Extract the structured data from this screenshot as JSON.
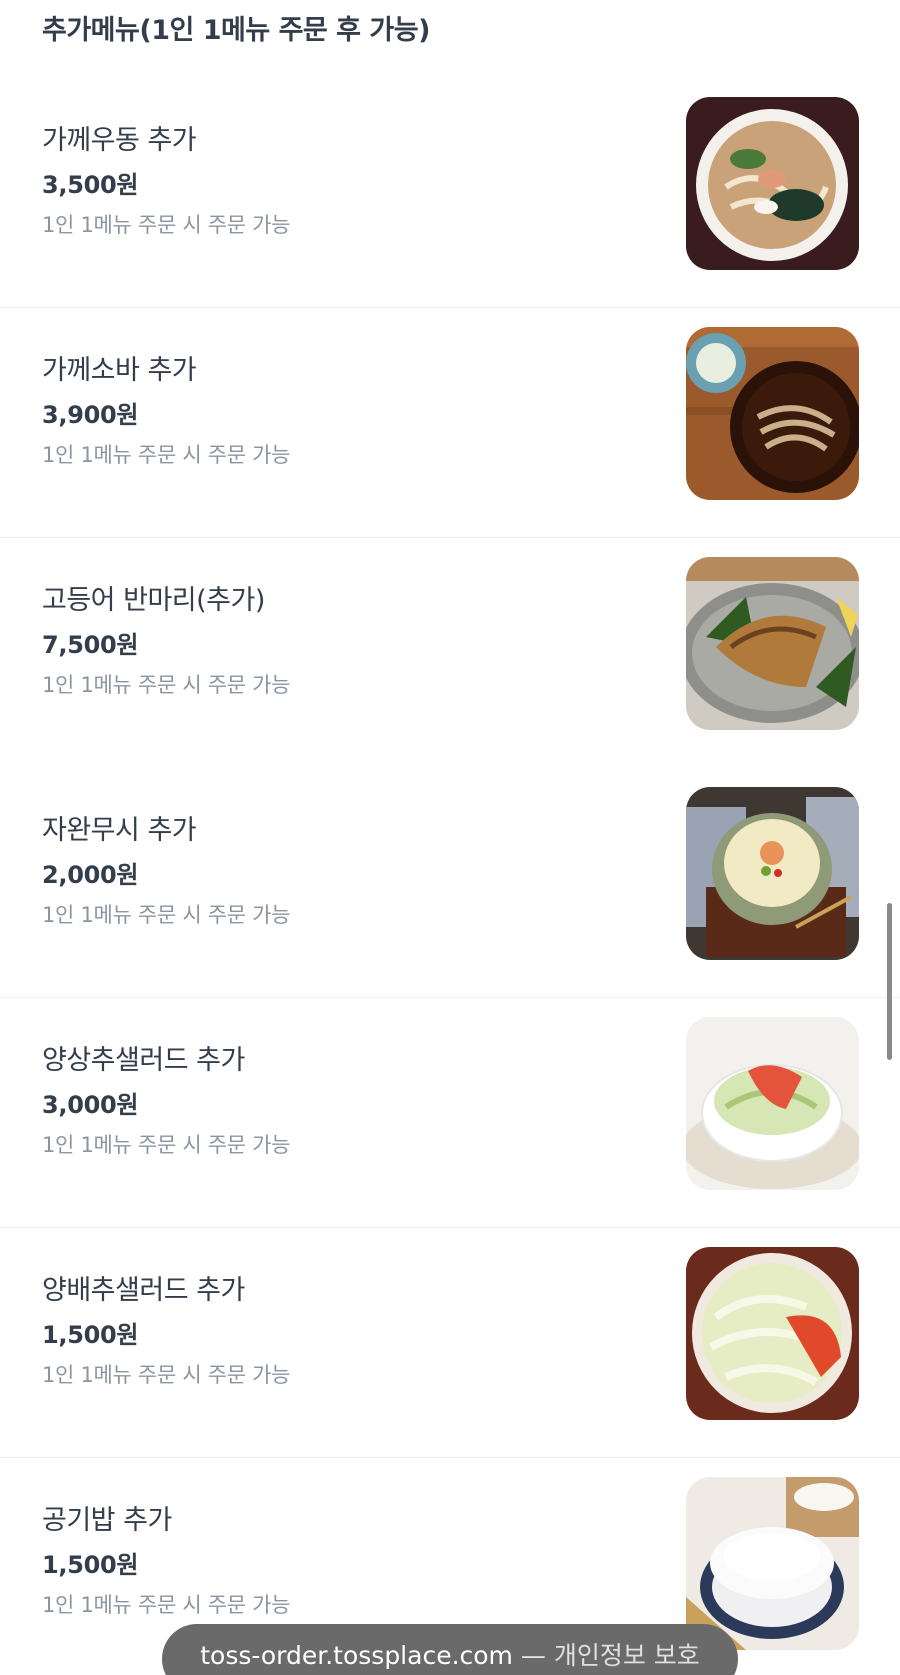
{
  "section": {
    "title": "추가메뉴(1인 1메뉴 주문 후 가능)"
  },
  "items": [
    {
      "name": "가께우동 추가",
      "price": "3,500원",
      "desc": "1인 1메뉴 주문 시 주문 가능",
      "image": "udon-bowl-photo"
    },
    {
      "name": "가께소바 추가",
      "price": "3,900원",
      "desc": "1인 1메뉴 주문 시 주문 가능",
      "image": "soba-bowl-photo"
    },
    {
      "name": "고등어 반마리(추가)",
      "price": "7,500원",
      "desc": "1인 1메뉴 주문 시 주문 가능",
      "image": "grilled-mackerel-photo"
    },
    {
      "name": "자완무시 추가",
      "price": "2,000원",
      "desc": "1인 1메뉴 주문 시 주문 가능",
      "image": "chawanmushi-photo"
    },
    {
      "name": "양상추샐러드 추가",
      "price": "3,000원",
      "desc": "1인 1메뉴 주문 시 주문 가능",
      "image": "lettuce-salad-photo"
    },
    {
      "name": "양배추샐러드 추가",
      "price": "1,500원",
      "desc": "1인 1메뉴 주문 시 주문 가능",
      "image": "cabbage-salad-photo"
    },
    {
      "name": "공기밥 추가",
      "price": "1,500원",
      "desc": "1인 1메뉴 주문 시 주문 가능",
      "image": "rice-bowl-photo"
    }
  ],
  "url_bar": {
    "domain": "toss-order.tossplace.com",
    "separator": "—",
    "note": "개인정보 보호"
  },
  "colors": {
    "text_primary": "#333d4b",
    "text_secondary": "#8b95a1",
    "divider": "#f0f1f3",
    "url_bar_bg": "#6a6a6a"
  }
}
